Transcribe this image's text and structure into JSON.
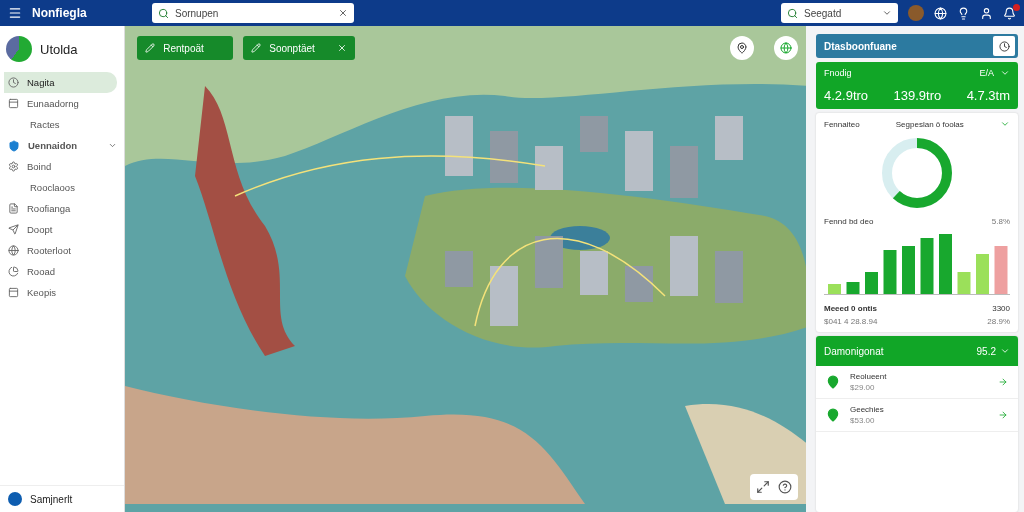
{
  "topbar": {
    "title": "Nonfiegla",
    "search": {
      "value": "Sornupen"
    },
    "filter": {
      "value": "Seegatd"
    },
    "notification_badge": true
  },
  "sidebar": {
    "brand": "Utolda",
    "items": [
      {
        "label": "Nagita",
        "selected": true,
        "kind": "icon"
      },
      {
        "label": "Eunaadorng",
        "selected": false,
        "kind": "icon"
      },
      {
        "label": "Ractes",
        "selected": false,
        "kind": "sub"
      },
      {
        "label": "Uennaidon",
        "selected": false,
        "kind": "group",
        "expanded": true
      },
      {
        "label": "Boind",
        "selected": false,
        "kind": "icon"
      },
      {
        "label": "Rooclaoos",
        "selected": false,
        "kind": "sub"
      },
      {
        "label": "Roofianga",
        "selected": false,
        "kind": "icon"
      },
      {
        "label": "Doopt",
        "selected": false,
        "kind": "icon"
      },
      {
        "label": "Rooterloot",
        "selected": false,
        "kind": "icon"
      },
      {
        "label": "Rooad",
        "selected": false,
        "kind": "icon"
      },
      {
        "label": "Keopis",
        "selected": false,
        "kind": "icon"
      }
    ],
    "footer": "Samjnerlt"
  },
  "map": {
    "actions": [
      {
        "label": "Rentpoät",
        "closable": false
      },
      {
        "label": "Soonptäet",
        "closable": true
      }
    ]
  },
  "panel": {
    "title": "Dtasboonfuane",
    "summary": {
      "label": "Fnodig",
      "unit": "E/A",
      "values": [
        "4.2.9tro",
        "139.9tro",
        "4.7.3tm"
      ]
    },
    "stats": {
      "tab_left": "Fennaiteo",
      "tab_center": "Segpeslan ö foolas",
      "bars_title": "Fennd bd deo",
      "bars_reading": "5.8%",
      "footer_title": "Meeed 0 ontis",
      "footer_value": "3300",
      "footer_sub": "$041 4  28.8.94",
      "footer_sub_value": "28.9%"
    },
    "list": {
      "title": "Damonigonat",
      "value": "95.2",
      "items": [
        {
          "name": "Reolueent",
          "amount": "$29.00"
        },
        {
          "name": "Geechies",
          "amount": "$53.00"
        }
      ]
    }
  }
}
